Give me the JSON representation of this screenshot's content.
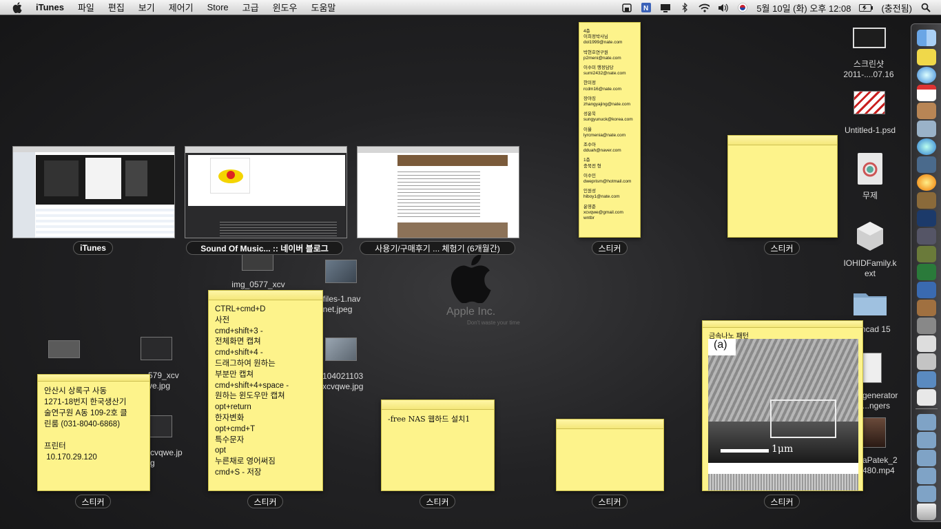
{
  "menubar": {
    "app_name": "iTunes",
    "menus": [
      "파일",
      "편집",
      "보기",
      "제어기",
      "Store",
      "고급",
      "윈도우",
      "도움말"
    ],
    "datetime": "5월 10일 (화) 오후 12:08",
    "user": "(충전됨)"
  },
  "windows": {
    "itunes": "iTunes",
    "sound_of_music": "Sound Of Music... :: 네이버 블로그",
    "review": "사용기/구매후기 ... 체험기 (6개월간)"
  },
  "sticker_label": "스티커",
  "stickies": {
    "contacts": [
      "4층",
      "이희정박사님",
      "dol1999@nate.com",
      "박현호연구원",
      "p2meni@nate.com",
      "이수미 행정담당",
      "sumi2432@nate.com",
      "한미정",
      "rcdm16@nate.com",
      "장야징",
      "zhangyajing@nate.com",
      "성윤욱",
      "sungyunuck@korea.com",
      "이율",
      "lyrcmenia@nate.com",
      "조수아",
      "dduah@naver.com",
      "1층",
      "충북전 형",
      "이수민",
      "dweprism@hotmail.com",
      "인원성",
      "hiboy1@nate.com",
      "윤영준",
      "xcvqwe@gmail.com",
      "wntbr"
    ],
    "shortcuts": [
      "CTRL+cmd+D",
      "사전",
      "cmd+shift+3 -",
      "전체화면 캡쳐",
      "cmd+shift+4 -",
      "드래그하여 원하는",
      "부분만 캡쳐",
      "cmd+shift+4+space -",
      "원하는 윈도우만 캡쳐",
      "opt+return",
      "한자변화",
      "opt+cmd+T",
      "특수문자",
      "opt",
      "누른채로 영어써짐",
      "cmd+S - 저장"
    ],
    "address": [
      "안산시 상록구 사동",
      "1271-18번지 한국생산기",
      "술연구원 A동 109-2호 클",
      "린룸 (031-8040-6868)",
      "",
      "프린터",
      " 10.170.29.120"
    ],
    "nas": "-free NAS 웹하드 설치1",
    "pattern_title": "금속나노 패턴",
    "pattern_a": "(a)",
    "pattern_scale": "1μm"
  },
  "desktop": {
    "img_0577": "img_0577_xcv",
    "nefiles": [
      "efiles-1.nav",
      "r.net.jpeg"
    ],
    "f104": [
      "104021103",
      "xcvqwe.jpg"
    ],
    "f579": [
      "579_xcv",
      "ve.jpg"
    ],
    "cxcv": [
      "cvqwe.jp",
      "g"
    ],
    "screenshot": [
      "스크린샷",
      "2011-....07.16"
    ],
    "untitled": "Untitled-1.psd",
    "muje": "무제",
    "iohid": [
      "IOHIDFamily.k",
      "ext"
    ],
    "ncad": "ncad 15",
    "generator": [
      "generator",
      "...ngers"
    ],
    "patek": [
      "aPatek_2",
      "480.mp4"
    ]
  },
  "apple_logo": {
    "company": "Apple Inc.",
    "slogan": "Don't waste your time"
  }
}
